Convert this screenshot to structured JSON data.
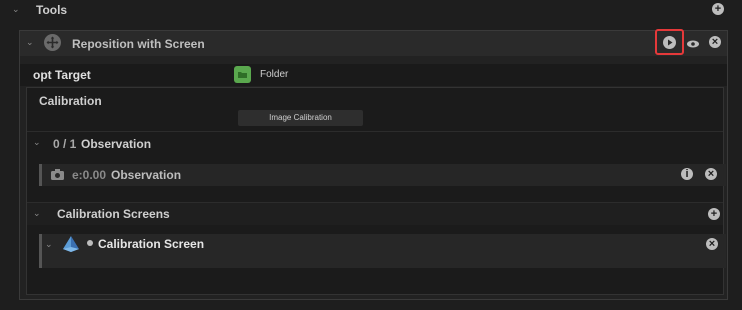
{
  "tools": {
    "title": "Tools"
  },
  "tool": {
    "name": "Reposition with Screen",
    "target_label": "opt Target",
    "target_value": "Folder"
  },
  "calibration": {
    "title": "Calibration",
    "button_label": "Image Calibration"
  },
  "observation_group": {
    "count": "0 / 1",
    "title": "Observation"
  },
  "observation_item": {
    "error": "e:0.00",
    "title": "Observation"
  },
  "screens": {
    "title": "Calibration Screens",
    "item_title": "Calibration Screen"
  },
  "colors": {
    "highlight": "#e5393a",
    "folder_green": "#5aa84e"
  }
}
